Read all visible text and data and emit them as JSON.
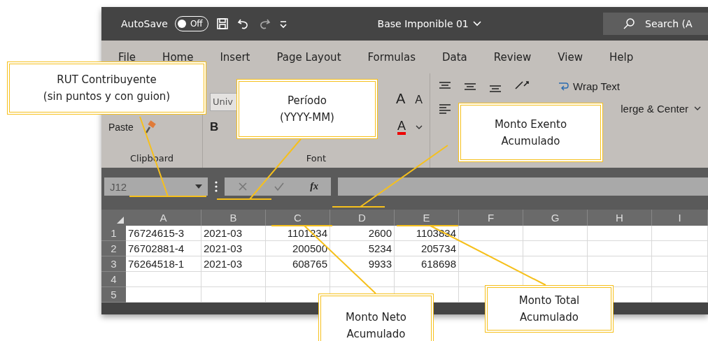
{
  "title_bar": {
    "autosave_label": "AutoSave",
    "autosave": {
      "label": "Off",
      "on": false
    },
    "document_title": "Base Imponible 01",
    "search_placeholder": "Search (A"
  },
  "ribbon_tabs": [
    "File",
    "Home",
    "Insert",
    "Page Layout",
    "Formulas",
    "Data",
    "Review",
    "View",
    "Help"
  ],
  "ribbon": {
    "clipboard": {
      "paste": "Paste",
      "label": "Clipboard"
    },
    "font": {
      "font_name": "Univ",
      "bold": "B",
      "grow": "A",
      "shrink": "A",
      "font_color_label": "A",
      "label": "Font"
    },
    "alignment": {
      "wrap_text": "Wrap Text",
      "merge": "lerge & Center"
    }
  },
  "formula_bar": {
    "name_box": "J12",
    "fx": "fx"
  },
  "sheet": {
    "columns": [
      {
        "label": "A",
        "kind": "text"
      },
      {
        "label": "B",
        "kind": "text"
      },
      {
        "label": "C",
        "kind": "number"
      },
      {
        "label": "D",
        "kind": "number"
      },
      {
        "label": "E",
        "kind": "number"
      },
      {
        "label": "F",
        "kind": "text"
      },
      {
        "label": "G",
        "kind": "text"
      },
      {
        "label": "H",
        "kind": "text"
      },
      {
        "label": "I",
        "kind": "text"
      }
    ],
    "rows": [
      {
        "number": "1",
        "cells": [
          "76724615-3",
          "2021-03",
          "1101234",
          "2600",
          "1103834"
        ]
      },
      {
        "number": "2",
        "cells": [
          "76702881-4",
          "2021-03",
          "200500",
          "5234",
          "205734"
        ]
      },
      {
        "number": "3",
        "cells": [
          "76264518-1",
          "2021-03",
          "608765",
          "9933",
          "618698"
        ]
      },
      {
        "number": "4",
        "cells": []
      },
      {
        "number": "5",
        "cells": []
      }
    ]
  },
  "callouts": [
    "RUT Contribuyente\n(sin puntos y con guion)",
    "Período\n(YYYY-MM)",
    "Monto Exento\nAcumulado",
    "Monto Neto\nAcumulado",
    "Monto Total\nAcumulado"
  ]
}
